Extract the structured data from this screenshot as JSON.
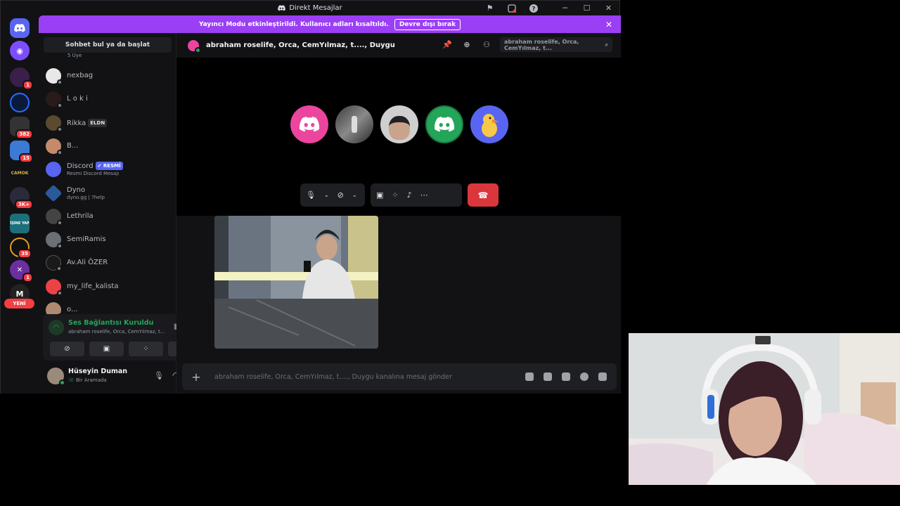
{
  "window": {
    "title": "Direkt Mesajlar"
  },
  "banner": {
    "text": "Yayıncı Modu etkinleştirildi. Kullanıcı adları kısaltıldı.",
    "button": "Devre dışı bırak"
  },
  "servers": [
    {
      "label": "",
      "badge": ""
    },
    {
      "label": "",
      "badge": "1"
    },
    {
      "label": "",
      "badge": ""
    },
    {
      "label": "",
      "badge": "382"
    },
    {
      "label": "",
      "badge": "15"
    },
    {
      "label": "CAMOK",
      "badge": ""
    },
    {
      "label": "",
      "badge": "3K+"
    },
    {
      "label": "İŞİNE YAP",
      "badge": ""
    },
    {
      "label": "",
      "badge": "35"
    },
    {
      "label": "",
      "badge": "1"
    },
    {
      "label": "M",
      "badge": ""
    }
  ],
  "new_label": "YENİ",
  "dm_search": "Sohbet bul ya da başlat",
  "dms": [
    {
      "name": "nexbag",
      "sub": "",
      "tag": ""
    },
    {
      "name": "L o k i",
      "sub": "",
      "tag": ""
    },
    {
      "name": "Rikka",
      "sub": "",
      "tag": "ELDN"
    },
    {
      "name": "B...",
      "sub": "",
      "tag": ""
    },
    {
      "name": "Discord",
      "sub": "Resmi Discord Mesajı",
      "tag": "✔ RESMİ"
    },
    {
      "name": "Dyno",
      "sub": "dyno.gg | ?help",
      "tag": ""
    },
    {
      "name": "Lethrila",
      "sub": "",
      "tag": ""
    },
    {
      "name": "SemiRamis",
      "sub": "",
      "tag": ""
    },
    {
      "name": "Av.Ali ÖZER",
      "sub": "",
      "tag": ""
    },
    {
      "name": "my_life_kalista",
      "sub": "",
      "tag": ""
    },
    {
      "name": "o...",
      "sub": "",
      "tag": ""
    }
  ],
  "dm_top_sub": "5 Üye",
  "voice": {
    "status": "Ses Bağlantısı Kuruldu",
    "channel": "abraham roselife, Orca, CemYılmaz, t..."
  },
  "user": {
    "name": "Hüseyin Duman",
    "status": "Bir Aramada"
  },
  "chat": {
    "title": "abraham roselife, Orca, CemYılmaz, t...., Duygu",
    "search_placeholder": "abraham roselife, Orca, CemYılmaz, t...",
    "composer_placeholder": "abraham roselife, Orca, CemYılmaz, t...., Duygu kanalına mesaj gönder"
  },
  "colors": {
    "brand": "#5865f2",
    "streamer": "#9b3ff5",
    "danger": "#da373c",
    "online": "#23a55a"
  }
}
